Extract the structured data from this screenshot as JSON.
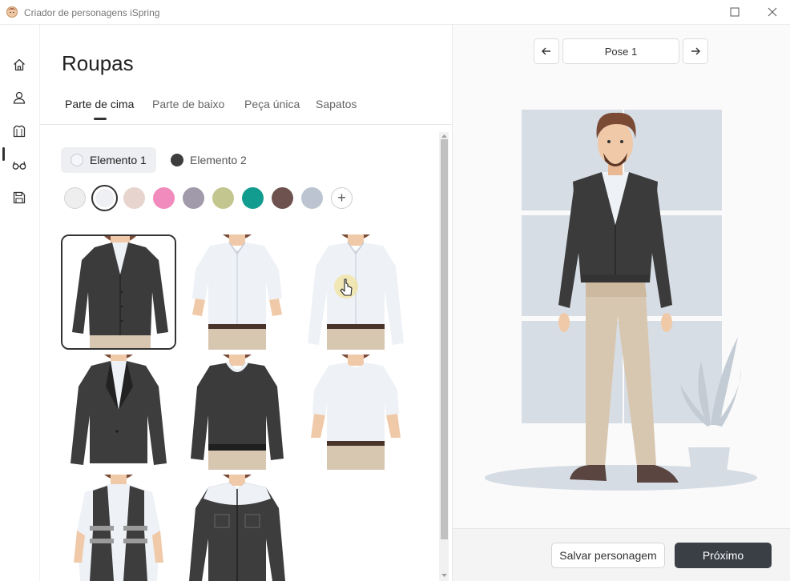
{
  "window": {
    "title": "Criador de personagens iSpring"
  },
  "rail": {
    "items": [
      {
        "icon": "home-icon"
      },
      {
        "icon": "user-icon"
      },
      {
        "icon": "shirt-icon",
        "active": true
      },
      {
        "icon": "glasses-icon"
      },
      {
        "icon": "save-icon"
      }
    ]
  },
  "panel": {
    "title": "Roupas",
    "tabs": [
      {
        "label": "Parte de cima",
        "active": true
      },
      {
        "label": "Parte de baixo"
      },
      {
        "label": "Peça única"
      },
      {
        "label": "Sapatos"
      }
    ],
    "elements": [
      {
        "label": "Elemento 1",
        "color": "#e9ecf4",
        "active": true
      },
      {
        "label": "Elemento 2",
        "color": "#3d3d3d"
      }
    ],
    "swatches": [
      "#eeeeee",
      "#eef0f4",
      "#e8d4ce",
      "#f28bbd",
      "#a19aaa",
      "#c3c68e",
      "#129c8f",
      "#6d5250",
      "#bcc4d1"
    ],
    "selected_swatch": 1,
    "add_swatch_label": "+",
    "garments": [
      {
        "name": "cardigan",
        "selected": true
      },
      {
        "name": "short-sleeve-shirt"
      },
      {
        "name": "long-sleeve-shirt"
      },
      {
        "name": "blazer"
      },
      {
        "name": "sweater"
      },
      {
        "name": "t-shirt"
      },
      {
        "name": "safety-vest"
      },
      {
        "name": "work-jacket"
      }
    ]
  },
  "preview": {
    "pose_label": "Pose 1",
    "prev_icon": "arrow-left-icon",
    "next_icon": "arrow-right-icon"
  },
  "footer": {
    "save_label": "Salvar personagem",
    "next_label": "Próximo"
  },
  "colors": {
    "accent": "#3a3f46",
    "cardigan": "#3b3b3b",
    "shirt": "#eef1f6",
    "pants": "#d8c7b0",
    "window_bg": "#d7dde4"
  }
}
